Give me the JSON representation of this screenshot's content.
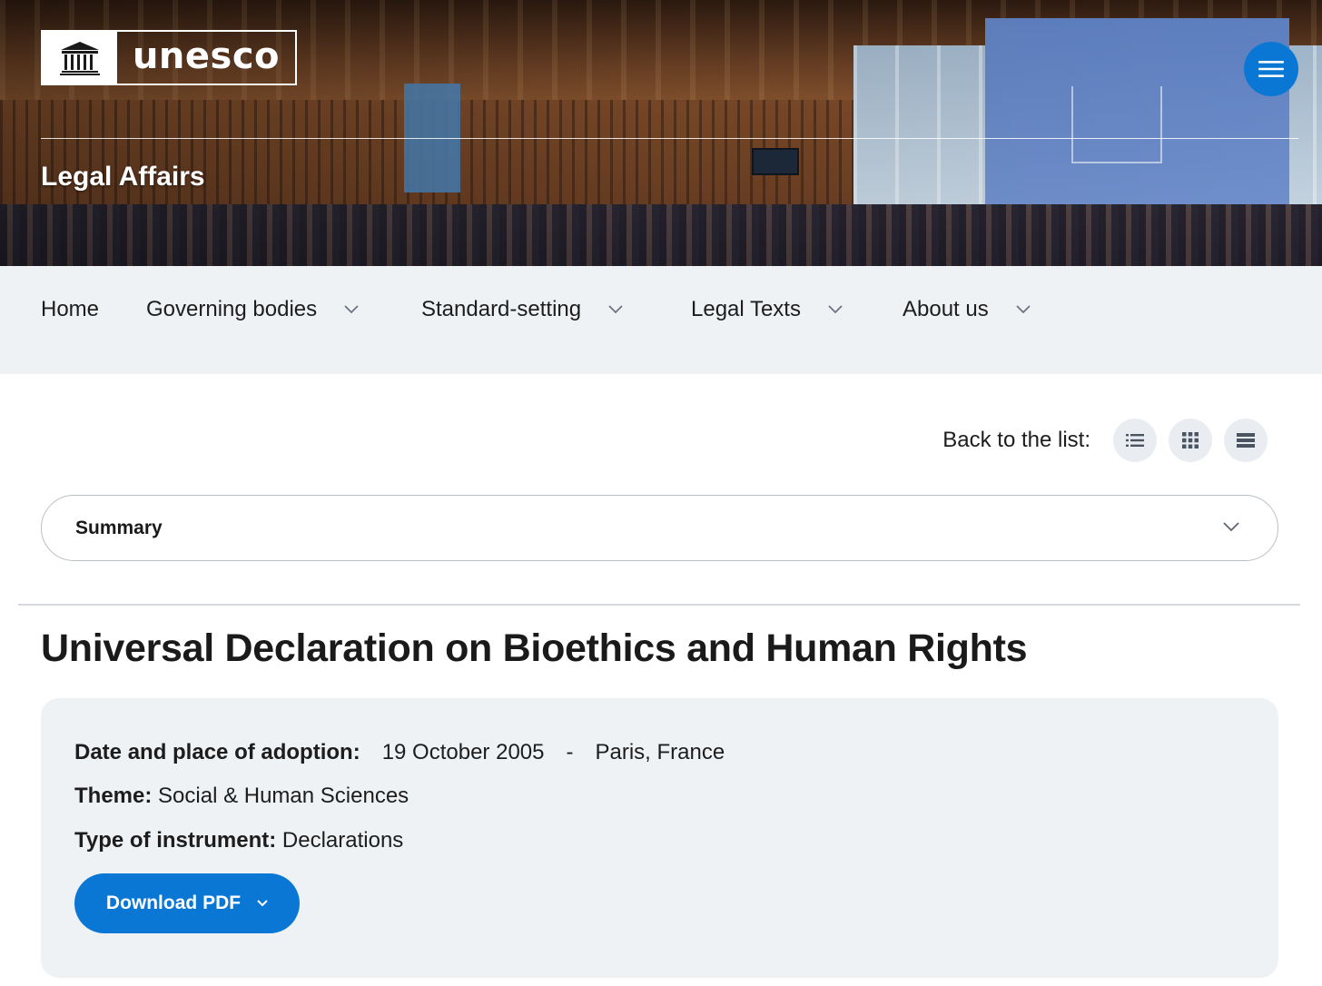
{
  "header": {
    "logo_text": "unesco",
    "section_title": "Legal Affairs",
    "menu_icon": "hamburger-menu-icon",
    "accent_color": "#0b77d5"
  },
  "nav": {
    "items": [
      {
        "label": "Home",
        "has_dropdown": false
      },
      {
        "label": "Governing bodies",
        "has_dropdown": true
      },
      {
        "label": "Standard-setting",
        "has_dropdown": true
      },
      {
        "label": "Legal Texts",
        "has_dropdown": true
      },
      {
        "label": "About us",
        "has_dropdown": true
      }
    ]
  },
  "back_to_list": {
    "label": "Back to the list:",
    "views": [
      "list-view-icon",
      "grid-view-icon",
      "rows-view-icon"
    ]
  },
  "summary": {
    "label": "Summary"
  },
  "document": {
    "title": "Universal Declaration on Bioethics and Human Rights",
    "adoption_label": "Date and place of adoption:",
    "adoption_date": "19 October 2005",
    "separator": "-",
    "adoption_place": "Paris, France",
    "theme_label": "Theme:",
    "theme_value": "Social & Human Sciences",
    "instrument_label": "Type of instrument:",
    "instrument_value": "Declarations",
    "download_label": "Download PDF"
  }
}
